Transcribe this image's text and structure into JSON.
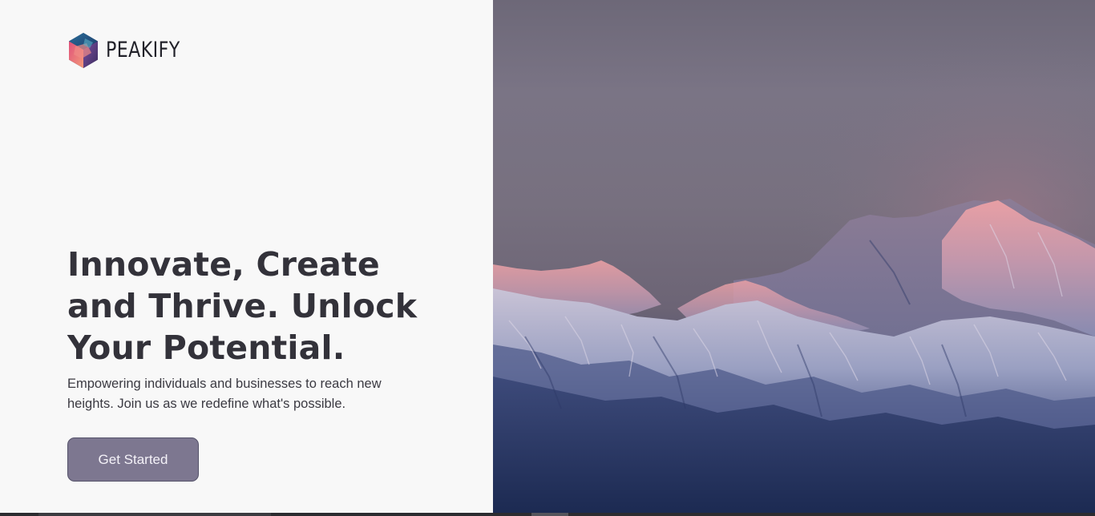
{
  "brand": {
    "name": "PEAKIFY",
    "logo_icon": "hexagon-gem-icon"
  },
  "hero": {
    "title": "Innovate, Create and Thrive. Unlock Your Potential.",
    "subtitle": "Empowering individuals and businesses to reach new heights. Join us as we redefine what's possible.",
    "cta_label": "Get Started"
  },
  "image": {
    "subject": "snow-mountain-range-at-dusk"
  },
  "colors": {
    "button_bg": "#7d7790",
    "text_dark": "#33323a",
    "panel_bg": "#f8f8f8"
  }
}
